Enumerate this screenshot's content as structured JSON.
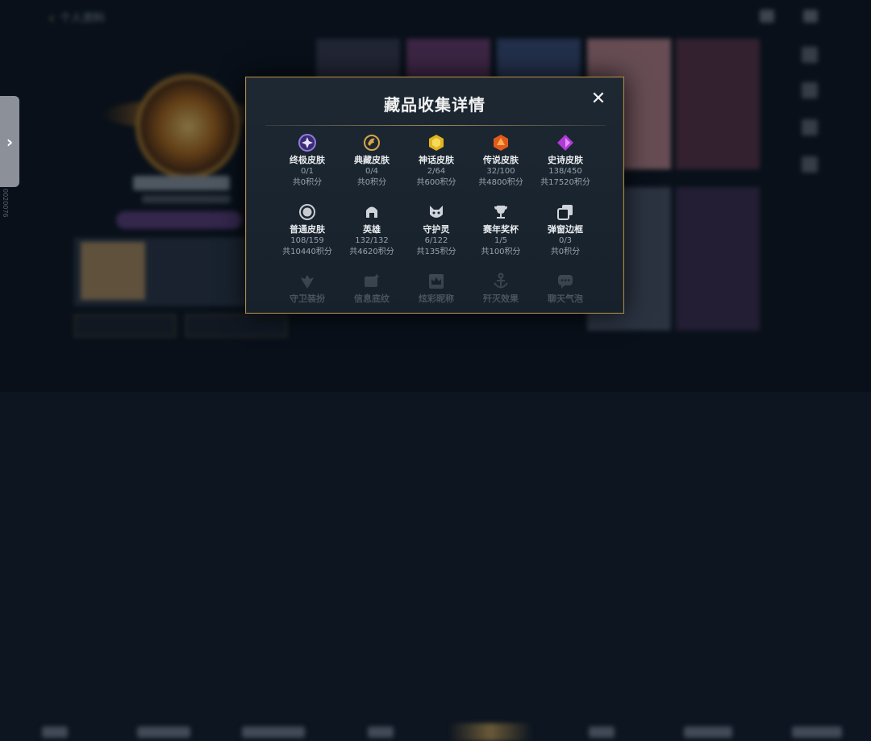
{
  "background": {
    "back_title": "个人资料",
    "side_id": "0020076"
  },
  "modal": {
    "title": "藏品收集详情",
    "close_symbol": "✕",
    "categories": [
      {
        "label": "终极皮肤",
        "count": "0/1",
        "points": "共0积分",
        "icon": "ultimate-gem-icon",
        "color": "#8f7be0"
      },
      {
        "label": "典藏皮肤",
        "count": "0/4",
        "points": "共0积分",
        "icon": "dragon-crest-icon",
        "color": "#d6a64a"
      },
      {
        "label": "神话皮肤",
        "count": "2/64",
        "points": "共600积分",
        "icon": "mythic-gem-icon",
        "color": "#e0b41e"
      },
      {
        "label": "传说皮肤",
        "count": "32/100",
        "points": "共4800积分",
        "icon": "legend-gem-icon",
        "color": "#e05a1e"
      },
      {
        "label": "史诗皮肤",
        "count": "138/450",
        "points": "共17520积分",
        "icon": "epic-gem-icon",
        "color": "#b03ad6"
      },
      {
        "label": "普通皮肤",
        "count": "108/159",
        "points": "共10440积分",
        "icon": "normal-ring-icon",
        "color": "#c8ccd2"
      },
      {
        "label": "英雄",
        "count": "132/132",
        "points": "共4620积分",
        "icon": "helmet-icon",
        "color": "#d0d4da"
      },
      {
        "label": "守护灵",
        "count": "6/122",
        "points": "共135积分",
        "icon": "guardian-icon",
        "color": "#d0d4da"
      },
      {
        "label": "赛年奖杯",
        "count": "1/5",
        "points": "共100积分",
        "icon": "trophy-icon",
        "color": "#d0d4da"
      },
      {
        "label": "弹窗边框",
        "count": "0/3",
        "points": "共0积分",
        "icon": "frame-stack-icon",
        "color": "#d0d4da"
      },
      {
        "label": "守卫装扮",
        "count": "",
        "points": "",
        "icon": "ward-icon",
        "color": "#7a828c"
      },
      {
        "label": "信息底纹",
        "count": "",
        "points": "",
        "icon": "card-star-icon",
        "color": "#7a828c"
      },
      {
        "label": "炫彩昵称",
        "count": "",
        "points": "",
        "icon": "crown-card-icon",
        "color": "#7a828c"
      },
      {
        "label": "歼灭效果",
        "count": "",
        "points": "",
        "icon": "anchor-icon",
        "color": "#7a828c"
      },
      {
        "label": "聊天气泡",
        "count": "",
        "points": "",
        "icon": "chat-bubble-icon",
        "color": "#7a828c"
      }
    ]
  },
  "colors": {
    "modal_border": "#a48a54",
    "modal_bg": "#1a2530",
    "text_primary": "#e9ecef",
    "text_secondary": "#9aa3ad"
  }
}
